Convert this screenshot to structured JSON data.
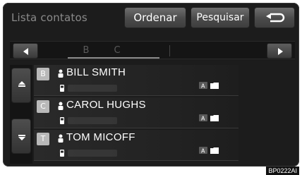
{
  "header": {
    "title": "Lista contatos",
    "sort_label": "Ordenar",
    "search_label": "Pesquisar",
    "back_icon": "back-arrow-icon"
  },
  "alphabet": {
    "tabs": [
      "B",
      "C"
    ],
    "left_icon": "arrow-left-icon",
    "right_icon": "arrow-right-icon"
  },
  "scroll": {
    "up_icon": "scroll-up-icon",
    "down_icon": "scroll-down-icon"
  },
  "contacts": [
    {
      "letter": "B",
      "name": "BILL SMITH"
    },
    {
      "letter": "C",
      "name": "CAROL HUGHS"
    },
    {
      "letter": "T",
      "name": "TOM MICOFF"
    }
  ],
  "caption": "BP0222AI",
  "colors": {
    "background": "#1c1c1c",
    "text": "#ffffff",
    "button": "#4a4a4a",
    "badge": "#b9b9b9"
  }
}
